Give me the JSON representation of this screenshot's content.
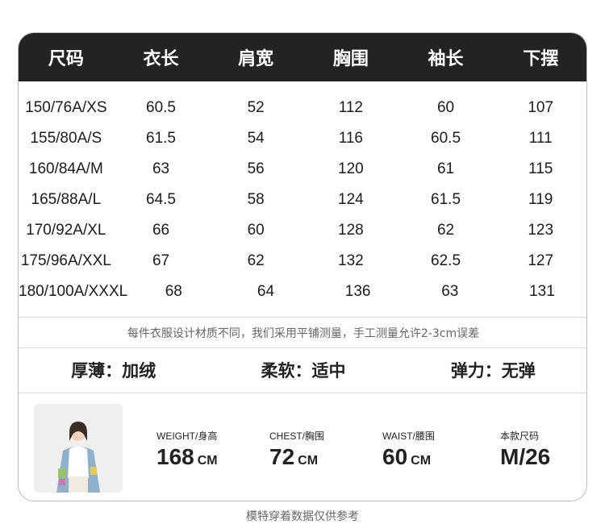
{
  "table": {
    "headers": [
      "尺码",
      "衣长",
      "肩宽",
      "胸围",
      "袖长",
      "下摆"
    ],
    "rows": [
      [
        "150/76A/XS",
        "60.5",
        "52",
        "112",
        "60",
        "107"
      ],
      [
        "155/80A/S",
        "61.5",
        "54",
        "116",
        "60.5",
        "111"
      ],
      [
        "160/84A/M",
        "63",
        "56",
        "120",
        "61",
        "115"
      ],
      [
        "165/88A/L",
        "64.5",
        "58",
        "124",
        "61.5",
        "119"
      ],
      [
        "170/92A/XL",
        "66",
        "60",
        "128",
        "62",
        "123"
      ],
      [
        "175/96A/XXL",
        "67",
        "62",
        "132",
        "62.5",
        "127"
      ],
      [
        "180/100A/XXXL",
        "68",
        "64",
        "136",
        "63",
        "131"
      ]
    ]
  },
  "note": "每件衣服设计材质不同，我们采用平铺测量，手工测量允许2-3cm误差",
  "properties": {
    "thickness": "厚薄：加绒",
    "softness": "柔软：适中",
    "elasticity": "弹力：无弹"
  },
  "model": {
    "weight": {
      "label": "WEIGHT/身高",
      "value": "168",
      "unit": "CM"
    },
    "chest": {
      "label": "CHEST/胸围",
      "value": "72",
      "unit": "CM"
    },
    "waist": {
      "label": "WAIST/腰围",
      "value": "60",
      "unit": "CM"
    },
    "size": {
      "label": "本款尺码",
      "value": "M/26"
    }
  },
  "footer": "模特穿着数据仅供参考",
  "colors": {
    "header_bg": "#232323",
    "border": "#bdbdbd",
    "text": "#222222"
  }
}
